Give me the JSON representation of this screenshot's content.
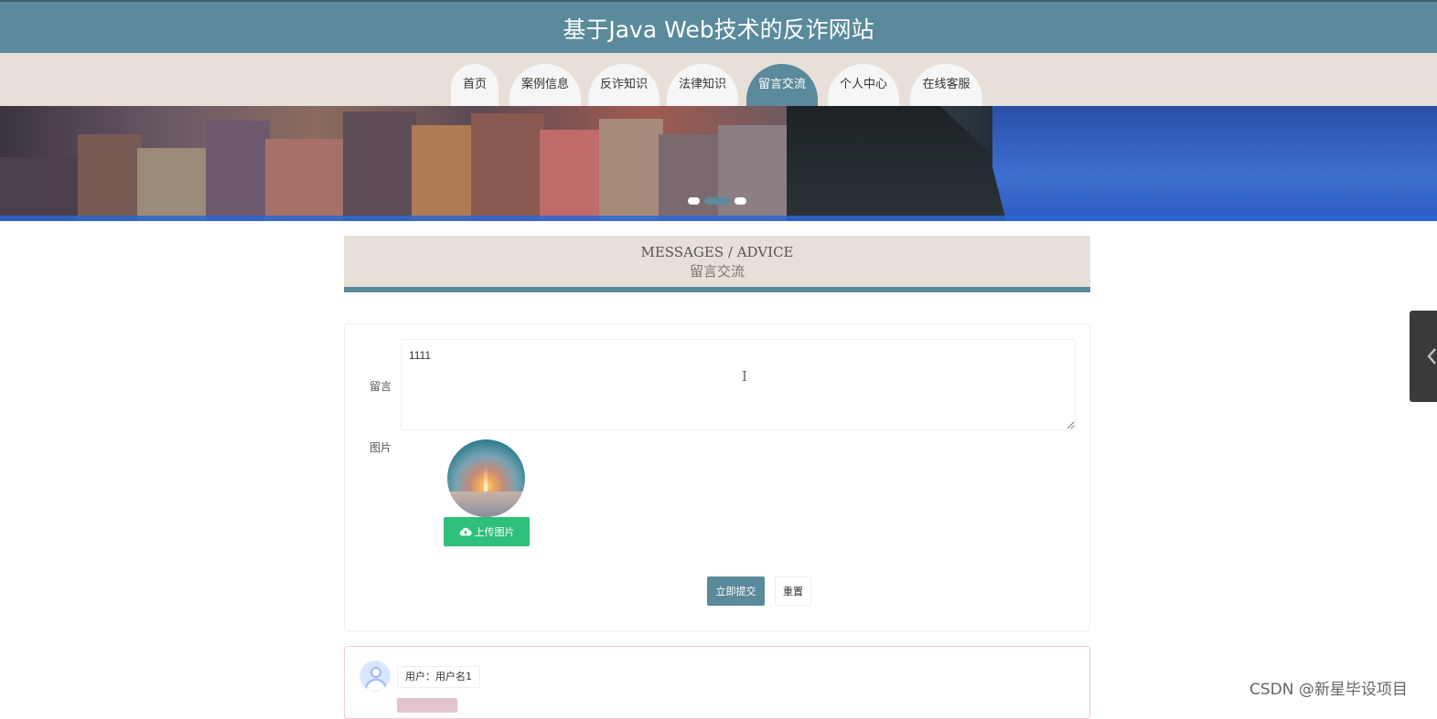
{
  "header": {
    "title": "基于Java Web技术的反诈网站"
  },
  "nav": {
    "items": [
      {
        "label": "首页"
      },
      {
        "label": "案例信息"
      },
      {
        "label": "反诈知识"
      },
      {
        "label": "法律知识"
      },
      {
        "label": "留言交流"
      },
      {
        "label": "个人中心"
      },
      {
        "label": "在线客服"
      }
    ],
    "active_index": 4
  },
  "carousel": {
    "slides": 3,
    "active_index": 1
  },
  "section": {
    "title_en": "MESSAGES / ADVICE",
    "title_zh": "留言交流"
  },
  "form": {
    "message_label": "留言",
    "message_value": "1111",
    "image_label": "图片",
    "upload_label": "上传图片",
    "submit_label": "立即提交",
    "reset_label": "重置"
  },
  "messages": [
    {
      "user_text": "用户：用户名1"
    }
  ],
  "watermark": "CSDN @新星毕设项目",
  "colors": {
    "primary": "#5a8a9b",
    "nav_bg": "#e8e0d8",
    "upload_green": "#2ebf7a",
    "card_pink_border": "#f1c9d6"
  },
  "icons": {
    "upload": "cloud-upload-icon",
    "side_tab": "chevron-left-icon",
    "avatar": "user-avatar-icon"
  }
}
